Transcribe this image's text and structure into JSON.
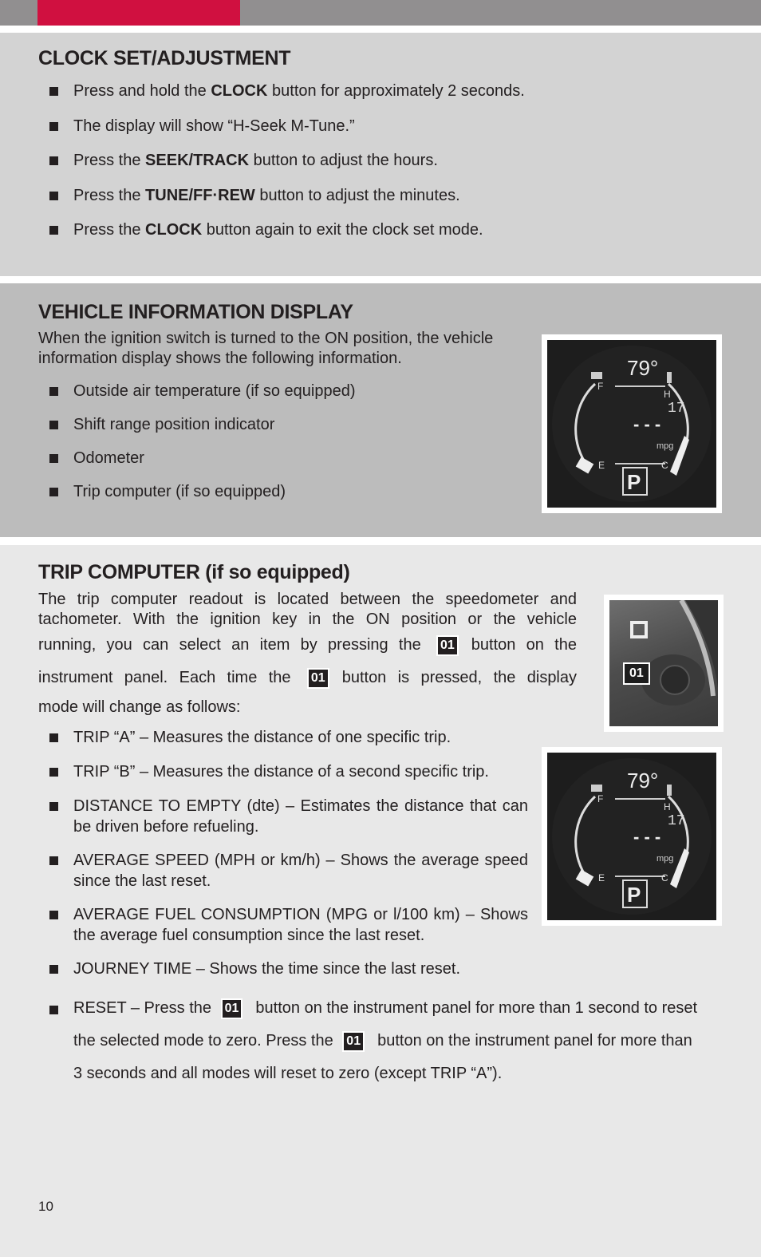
{
  "header": {
    "accent_color": "#d01040",
    "bar_color": "#918f90"
  },
  "clock_section": {
    "title": "CLOCK SET/ADJUSTMENT",
    "items": [
      {
        "pre": "Press and hold the ",
        "bold": "CLOCK",
        "post": " button for approximately 2 seconds."
      },
      {
        "pre": "The display will show “H-Seek M-Tune.”",
        "bold": "",
        "post": ""
      },
      {
        "pre": "Press the ",
        "bold": "SEEK/TRACK",
        "post": " button to adjust the hours."
      },
      {
        "pre": "Press the ",
        "bold": "TUNE/FF·REW",
        "post": " button to adjust the minutes."
      },
      {
        "pre": "Press the ",
        "bold": "CLOCK",
        "post": " button again to exit the clock set mode."
      }
    ]
  },
  "vehicle_info_section": {
    "title": "VEHICLE INFORMATION DISPLAY",
    "intro_1": "When the ignition switch is turned to the ON position, the vehicle",
    "intro_2": "information display shows the following information.",
    "items": [
      "Outside air temperature (if so equipped)",
      "Shift range position indicator",
      "Odometer",
      "Trip computer (if so equipped)"
    ],
    "display_image": {
      "temperature": "79°",
      "gear": "P",
      "value": "- - -",
      "unit": "mpg",
      "fuel_low": "E",
      "fuel_high": "F",
      "temp_low": "C",
      "temp_high": "H"
    }
  },
  "trip_section": {
    "title": "TRIP COMPUTER (if so equipped)",
    "intro": {
      "line1": "The trip computer readout is located between the speedometer and",
      "line2": "tachometer. With the ignition key in the ON position or the vehicle",
      "line3_pre": "running, you can select an item by pressing the",
      "line3_post": "button on the",
      "line4_pre": "instrument panel. Each time the",
      "line4_post": "button is pressed, the display",
      "line5": "mode will change as follows:"
    },
    "button_badge": "01",
    "items": [
      "TRIP “A” – Measures the distance of one specific trip.",
      "TRIP “B” – Measures the distance of a second specific trip.",
      "DISTANCE TO EMPTY (dte) – Estimates the distance that can be driven before refueling.",
      "AVERAGE SPEED (MPH or km/h) – Shows the average speed since the last reset.",
      "AVERAGE FUEL CONSUMPTION (MPG or l/100 km) – Shows the average fuel consumption since the last reset.",
      "JOURNEY TIME – Shows the time since the last reset."
    ],
    "reset": {
      "line1_pre": "RESET – Press the",
      "line1_post": "button on the instrument panel for more than 1 second to reset",
      "line2_pre": "the selected mode to zero. Press the",
      "line2_post": "button on the instrument panel for more than",
      "line3": "3 seconds and all modes will reset to zero (except TRIP “A”)."
    }
  },
  "page_number": "10"
}
